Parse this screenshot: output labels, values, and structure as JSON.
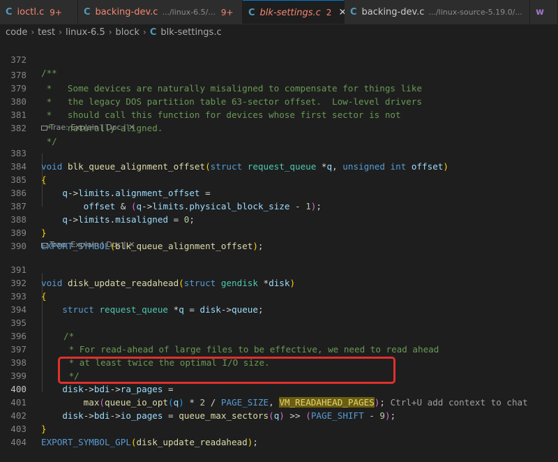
{
  "tabs": [
    {
      "icon": "C",
      "name": "ioctl.c",
      "path": "",
      "count": "9+",
      "active": false
    },
    {
      "icon": "C",
      "name": "backing-dev.c",
      "path": ".../linux-6.5/...",
      "count": "9+",
      "active": false
    },
    {
      "icon": "C",
      "name": "blk-settings.c",
      "path": "",
      "count": "2",
      "active": true,
      "close": "✕"
    },
    {
      "icon": "C",
      "name": "backing-dev.c",
      "path": ".../linux-source-5.19.0/...",
      "count": "",
      "active": false
    },
    {
      "icon": "C",
      "name": "w",
      "path": "",
      "count": "",
      "active": false
    }
  ],
  "breadcrumb": {
    "items": [
      "code",
      "test",
      "linux-6.5",
      "block"
    ],
    "file_icon": "C",
    "file": "blk-settings.c"
  },
  "codelens": {
    "lens1": "Trae: Explain | Doc | ✕",
    "lens2": "Trae: Explain | Doc | ✕"
  },
  "editor": {
    "current_line": "400",
    "inline_hint": "Ctrl+U add context to chat",
    "lines": [
      {
        "n": "372"
      },
      {
        "n": "378"
      },
      {
        "n": "379"
      },
      {
        "n": "380"
      },
      {
        "n": "381"
      },
      {
        "n": "382"
      },
      {
        "n": "383"
      },
      {
        "n": "384"
      },
      {
        "n": "385"
      },
      {
        "n": "386"
      },
      {
        "n": "387"
      },
      {
        "n": "388"
      },
      {
        "n": "389"
      },
      {
        "n": "390"
      },
      {
        "n": "391"
      },
      {
        "n": "392"
      },
      {
        "n": "393"
      },
      {
        "n": "394"
      },
      {
        "n": "395"
      },
      {
        "n": "396"
      },
      {
        "n": "397"
      },
      {
        "n": "398"
      },
      {
        "n": "399"
      },
      {
        "n": "400"
      },
      {
        "n": "401"
      },
      {
        "n": "402"
      },
      {
        "n": "403"
      },
      {
        "n": "404"
      }
    ],
    "text": {
      "l372": "/**",
      "l378": " *   Some devices are naturally misaligned to compensate for things like",
      "l379": " *   the legacy DOS partition table 63-sector offset.  Low-level drivers",
      "l380": " *   should call this function for devices whose first sector is not",
      "l381": " *   naturally aligned.",
      "l382": " */",
      "l395": "/*",
      "l396": " * For read-ahead of large files to be effective, we need to read ahead",
      "l397": " * at least twice the optimal I/O size.",
      "l398": " */"
    },
    "tokens": {
      "void": "void",
      "struct": "struct",
      "unsigned": "unsigned",
      "int": "int",
      "fn_align": "blk_queue_alignment_offset",
      "request_queue": "request_queue",
      "q": "q",
      "offset": "offset",
      "alignment_offset": "alignment_offset",
      "limits": "limits",
      "physical_block_size": "physical_block_size",
      "misaligned": "misaligned",
      "export": "EXPORT_SYMBOL",
      "export_gpl": "EXPORT_SYMBOL_GPL",
      "fn_readahead": "disk_update_readahead",
      "gendisk": "gendisk",
      "disk": "disk",
      "queue": "queue",
      "bdi": "bdi",
      "ra_pages": "ra_pages",
      "io_pages": "io_pages",
      "max": "max",
      "queue_io_opt": "queue_io_opt",
      "page_size": "PAGE_SIZE",
      "vm_ra": "VM_READAHEAD_PAGES",
      "queue_max_sectors": "queue_max_sectors",
      "page_shift": "PAGE_SHIFT",
      "zero": "0",
      "one": "1",
      "two": "2",
      "nine": "9"
    }
  }
}
